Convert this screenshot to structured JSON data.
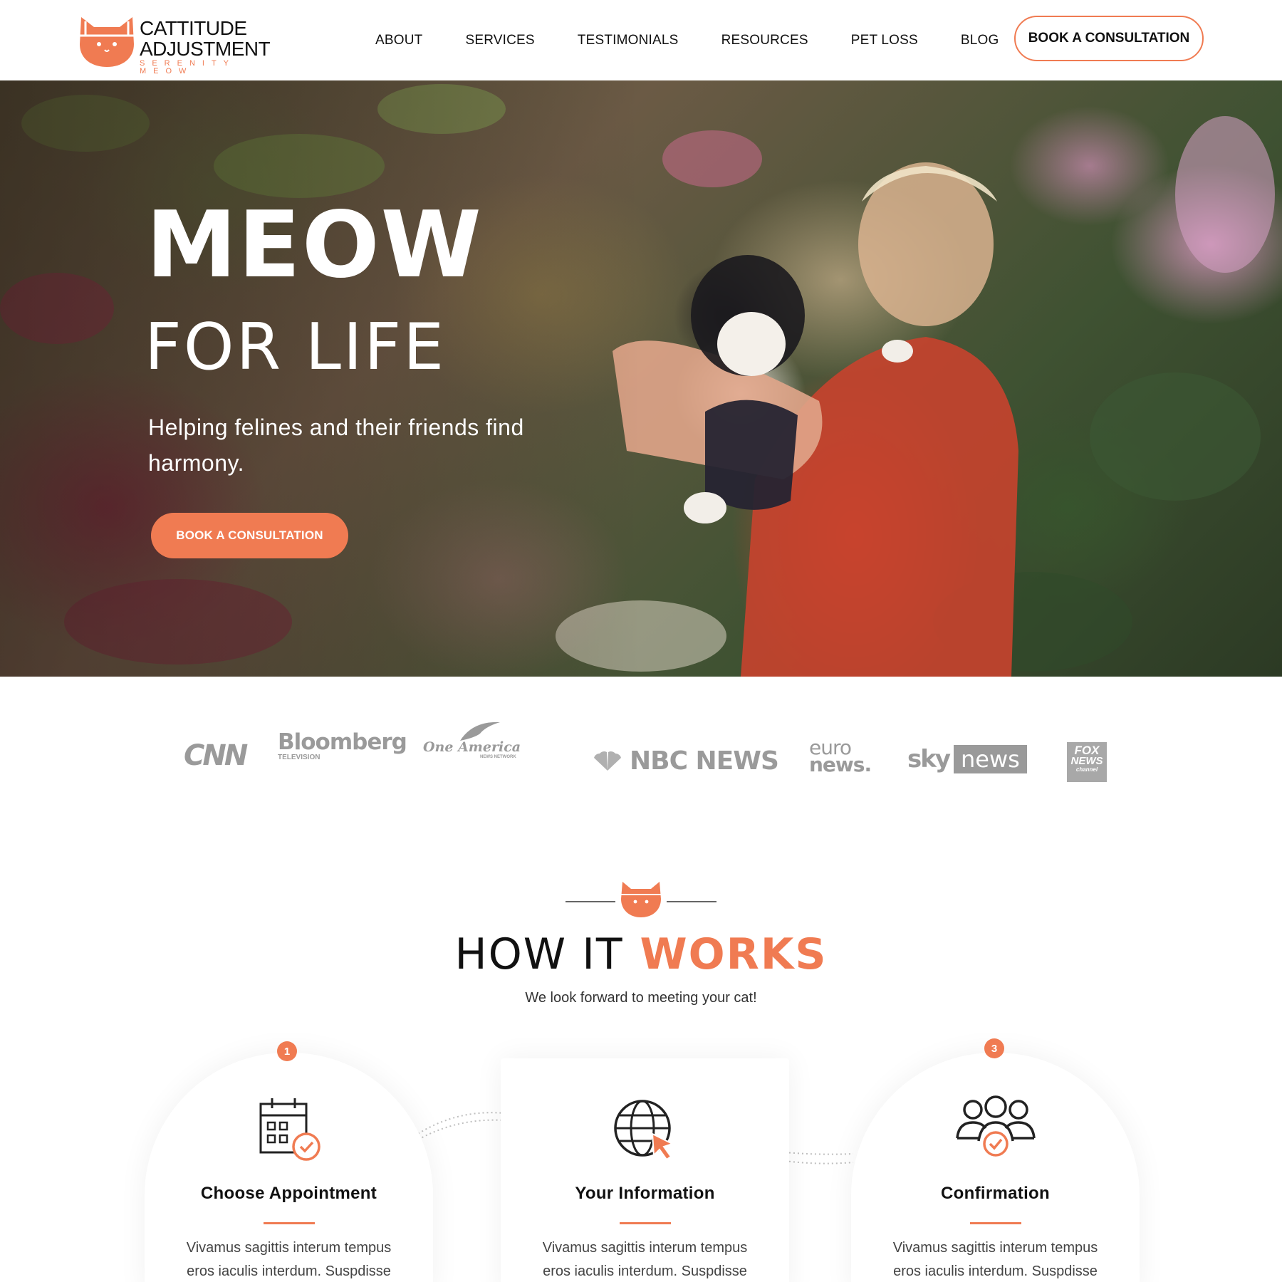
{
  "brand": {
    "line1": "CATTITUDE",
    "line2": "ADJUSTMENT",
    "tagline": "SERENITY MEOW",
    "accent": "#f07b52"
  },
  "nav": {
    "items": [
      "ABOUT",
      "SERVICES",
      "TESTIMONIALS",
      "RESOURCES",
      "PET LOSS",
      "BLOG"
    ],
    "cta": "BOOK A CONSULTATION"
  },
  "hero": {
    "title": "MEOW",
    "subtitle": "FOR LIFE",
    "tagline": "Helping felines and their friends find harmony.",
    "cta": "BOOK A CONSULTATION"
  },
  "press": {
    "logos": [
      "CNN",
      "Bloomberg",
      "TELEVISION",
      "One America",
      "NEWS NETWORK",
      "NBC NEWS",
      "euro",
      "news.",
      "sky",
      "news",
      "FOX",
      "NEWS",
      "channel"
    ]
  },
  "how_it_works": {
    "title_part1": "HOW IT",
    "title_part2": "WORKS",
    "subtitle": "We look forward to meeting your cat!",
    "steps": [
      {
        "number": "1",
        "icon": "calendar-check-icon",
        "title": "Choose Appointment",
        "text": "Vivamus sagittis interum tempus eros iaculis interdum. Suspdisse"
      },
      {
        "number": "",
        "icon": "globe-cursor-icon",
        "title": "Your Information",
        "text": "Vivamus sagittis interum tempus eros iaculis interdum. Suspdisse"
      },
      {
        "number": "3",
        "icon": "group-check-icon",
        "title": "Confirmation",
        "text": "Vivamus sagittis interum tempus eros iaculis interdum. Suspdisse"
      }
    ]
  }
}
